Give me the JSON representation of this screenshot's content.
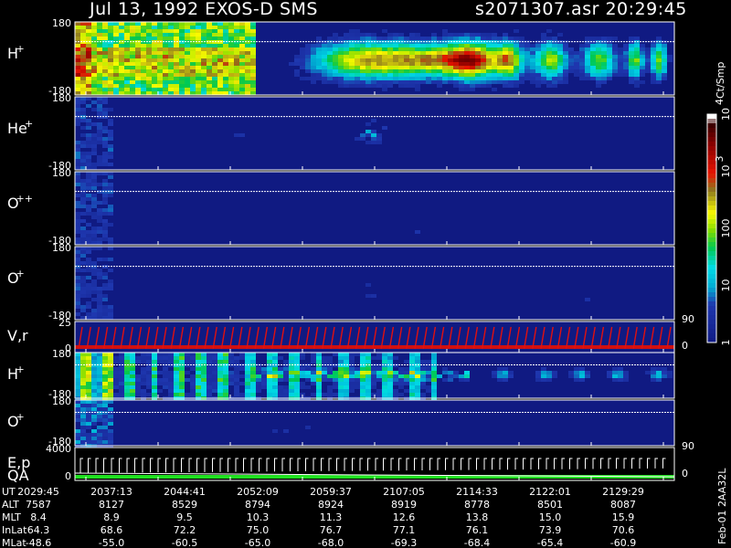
{
  "header": {
    "title": "Jul 13, 1992   EXOS-D SMS",
    "file": "s2071307.asr  20:29:45"
  },
  "panels": [
    {
      "id": "h-plus-1",
      "label": "H",
      "sup": "+",
      "ytop": "180",
      "ybot": "-180",
      "top": 24,
      "bottom": 104,
      "kind": "spectro",
      "species": "h"
    },
    {
      "id": "he-plus",
      "label": "He",
      "sup": "+",
      "ytop": "180",
      "ybot": "-180",
      "top": 106,
      "bottom": 186,
      "kind": "spectro",
      "species": "he"
    },
    {
      "id": "o-plusplus",
      "label": "O",
      "sup": "++",
      "ytop": "180",
      "ybot": "-180",
      "top": 188,
      "bottom": 268,
      "kind": "spectro",
      "species": "opp"
    },
    {
      "id": "o-plus-1",
      "label": "O",
      "sup": "+",
      "ytop": "180",
      "ybot": "-180",
      "top": 270,
      "bottom": 350,
      "kind": "spectro",
      "species": "op"
    },
    {
      "id": "vr",
      "label": "V,r",
      "sup": "",
      "ytop": "25",
      "ybot": "0",
      "top": 352,
      "bottom": 386,
      "kind": "sawtooth",
      "right_top": "90",
      "right_bot": "0"
    },
    {
      "id": "h-plus-2",
      "label": "H",
      "sup": "+",
      "ytop": "180",
      "ybot": "-180",
      "top": 386,
      "bottom": 436,
      "kind": "spectro",
      "species": "h2"
    },
    {
      "id": "o-plus-2",
      "label": "O",
      "sup": "+",
      "ytop": "180",
      "ybot": "-180",
      "top": 438,
      "bottom": 488,
      "kind": "spectro",
      "species": "op2"
    },
    {
      "id": "ep",
      "label": "E,p",
      "sup": "",
      "ytop": "4000",
      "ybot": "0",
      "top": 490,
      "bottom": 526,
      "kind": "steps",
      "right_top": "90",
      "right_bot": "0",
      "sub_label": "QA"
    }
  ],
  "colorbar": {
    "unit": "Ct/Smp",
    "ticks": [
      {
        "label": "10",
        "sup": "4",
        "v": 4
      },
      {
        "label": "10",
        "sup": "3",
        "v": 3
      },
      {
        "label": "100",
        "sup": "",
        "v": 2
      },
      {
        "label": "10",
        "sup": "",
        "v": 1
      },
      {
        "label": "1",
        "sup": "",
        "v": 0
      }
    ]
  },
  "side_note": "Feb-01 2AA32L",
  "table": {
    "row_labels": [
      "UT",
      "ALT",
      "MLT",
      "InLat",
      "MLat"
    ],
    "columns": [
      [
        "2029:45",
        "7587",
        "8.4",
        "64.3",
        "-48.6"
      ],
      [
        "2037:13",
        "8127",
        "8.9",
        "68.6",
        "-55.0"
      ],
      [
        "2044:41",
        "8529",
        "9.5",
        "72.2",
        "-60.5"
      ],
      [
        "2052:09",
        "8794",
        "10.3",
        "75.0",
        "-65.0"
      ],
      [
        "2059:37",
        "8924",
        "11.3",
        "76.7",
        "-68.0"
      ],
      [
        "2107:05",
        "8919",
        "12.6",
        "77.1",
        "-69.3"
      ],
      [
        "2114:33",
        "8778",
        "13.8",
        "76.1",
        "-68.4"
      ],
      [
        "2122:01",
        "8501",
        "15.0",
        "73.9",
        "-65.4"
      ],
      [
        "2129:29",
        "8087",
        "15.9",
        "70.6",
        "-60.9"
      ]
    ]
  },
  "chart_data": {
    "type": "heatmap",
    "title": "Jul 13, 1992   EXOS-D SMS",
    "colorbar_label": "Ct/Smp",
    "colorbar_range_log10": [
      0,
      4
    ],
    "x_ticks": [
      "2029:45",
      "2037:13",
      "2044:41",
      "2052:09",
      "2059:37",
      "2107:05",
      "2114:33",
      "2122:01",
      "2129:29"
    ],
    "series": [
      {
        "name": "H+",
        "ylim": [
          -180,
          180
        ]
      },
      {
        "name": "He+",
        "ylim": [
          -180,
          180
        ]
      },
      {
        "name": "O++",
        "ylim": [
          -180,
          180
        ]
      },
      {
        "name": "O+",
        "ylim": [
          -180,
          180
        ]
      },
      {
        "name": "V,r",
        "ylim": [
          0,
          25
        ]
      },
      {
        "name": "H+",
        "ylim": [
          -180,
          180
        ]
      },
      {
        "name": "O+",
        "ylim": [
          -180,
          180
        ]
      },
      {
        "name": "E,p",
        "ylim": [
          0,
          4000
        ]
      }
    ]
  }
}
